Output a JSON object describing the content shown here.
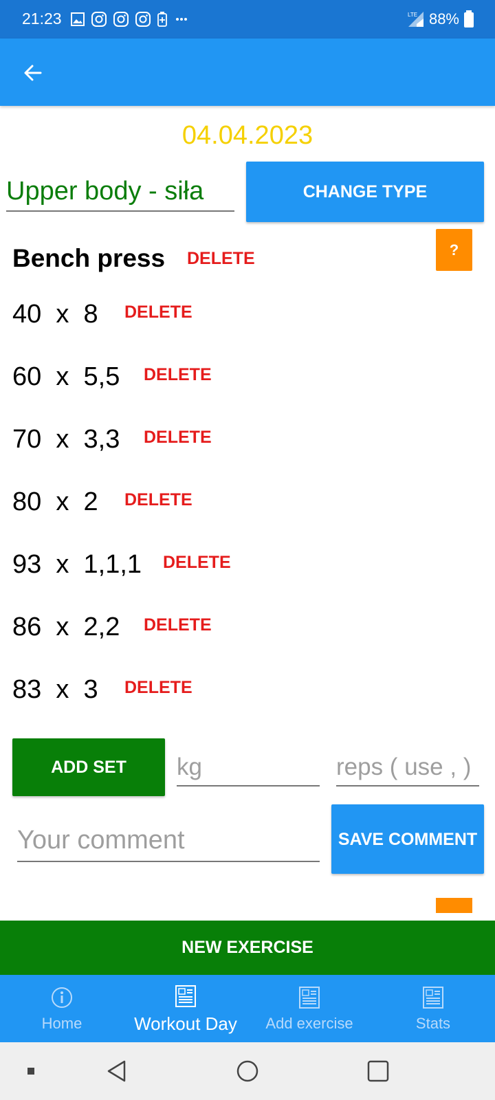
{
  "status_bar": {
    "time": "21:23",
    "network": "LTE",
    "battery": "88%",
    "icons": [
      "gallery-icon",
      "instagram-icon",
      "instagram-icon",
      "instagram-icon",
      "battery-saver-icon",
      "more-dots-icon"
    ]
  },
  "app_bar": {
    "back_icon": "arrow-left-icon"
  },
  "workout": {
    "date": "04.04.2023",
    "type": "Upper body - siła",
    "change_type_label": "CHANGE TYPE",
    "help_label": "?"
  },
  "exercise": {
    "name": "Bench press",
    "delete_label": "DELETE",
    "sets": [
      {
        "text": "40  x  8",
        "delete_label": "DELETE"
      },
      {
        "text": "60  x  5,5",
        "delete_label": "DELETE"
      },
      {
        "text": "70  x  3,3",
        "delete_label": "DELETE"
      },
      {
        "text": "80  x  2",
        "delete_label": "DELETE"
      },
      {
        "text": "93  x  1,1,1",
        "delete_label": "DELETE"
      },
      {
        "text": "86  x  2,2",
        "delete_label": "DELETE"
      },
      {
        "text": "83  x  3",
        "delete_label": "DELETE"
      }
    ],
    "add_set_label": "ADD SET",
    "kg_placeholder": "kg",
    "reps_placeholder": "reps ( use , )",
    "comment_placeholder": "Your comment",
    "save_comment_label": "SAVE COMMENT"
  },
  "new_exercise_label": "NEW EXERCISE",
  "bottom_nav": [
    {
      "label": "Home",
      "icon": "info-icon",
      "active": false
    },
    {
      "label": "Workout Day",
      "icon": "newspaper-icon",
      "active": true
    },
    {
      "label": "Add exercise",
      "icon": "newspaper-icon",
      "active": false
    },
    {
      "label": "Stats",
      "icon": "newspaper-icon",
      "active": false
    }
  ],
  "colors": {
    "status_bar": "#1a76d2",
    "primary": "#2196f3",
    "green": "#087f08",
    "delete_red": "#e51c1c",
    "date_yellow": "#f5d000",
    "help_orange": "#ff8c00"
  }
}
